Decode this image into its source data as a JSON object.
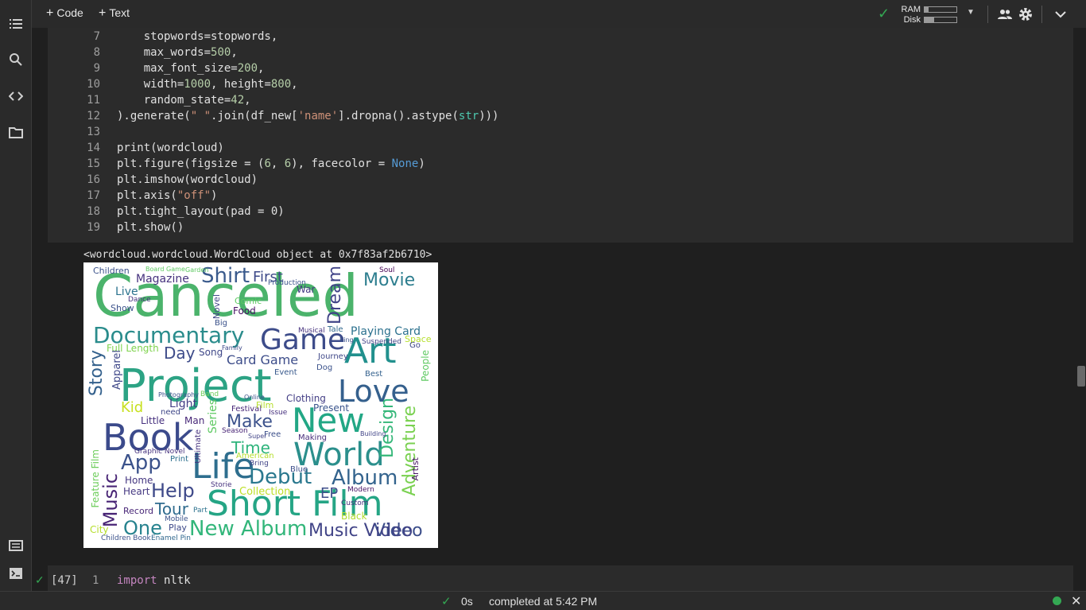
{
  "toolbar": {
    "add_code": "Code",
    "add_text": "Text",
    "ram_label": "RAM",
    "disk_label": "Disk",
    "ram_usage": 0.12,
    "disk_usage": 0.3
  },
  "sidebar": {
    "items": [
      "table-of-contents-icon",
      "search-icon",
      "code-snippets-icon",
      "files-icon",
      "command-palette-icon",
      "terminal-icon"
    ]
  },
  "cell": {
    "lines": [
      {
        "n": "7",
        "code": "    stopwords=stopwords,"
      },
      {
        "n": "8",
        "code": "    max_words=500,"
      },
      {
        "n": "9",
        "code": "    max_font_size=200,"
      },
      {
        "n": "10",
        "code": "    width=1000, height=800,"
      },
      {
        "n": "11",
        "code": "    random_state=42,"
      },
      {
        "n": "12",
        "code": ").generate(\" \".join(df_new['name'].dropna().astype(str)))"
      },
      {
        "n": "13",
        "code": ""
      },
      {
        "n": "14",
        "code": "print(wordcloud)"
      },
      {
        "n": "15",
        "code": "plt.figure(figsize = (6, 6), facecolor = None)"
      },
      {
        "n": "16",
        "code": "plt.imshow(wordcloud)"
      },
      {
        "n": "17",
        "code": "plt.axis(\"off\")"
      },
      {
        "n": "18",
        "code": "plt.tight_layout(pad = 0)"
      },
      {
        "n": "19",
        "code": "plt.show()"
      }
    ]
  },
  "output": {
    "text": "<wordcloud.wordcloud.WordCloud object at 0x7f83af2b6710>"
  },
  "wordcloud": {
    "words": [
      {
        "t": "Canceled",
        "c": "#4bb36b"
      },
      {
        "t": "Project",
        "c": "#2ca384"
      },
      {
        "t": "Book",
        "c": "#3b4a8b"
      },
      {
        "t": "Short Film",
        "c": "#25a585"
      },
      {
        "t": "World",
        "c": "#2b8f8c"
      },
      {
        "t": "Life",
        "c": "#2e6e8e"
      },
      {
        "t": "New",
        "c": "#22a785"
      },
      {
        "t": "Art",
        "c": "#21908d"
      },
      {
        "t": "Love",
        "c": "#35608d"
      },
      {
        "t": "Game",
        "c": "#3d4c8a"
      },
      {
        "t": "Documentary",
        "c": "#2a8c8c"
      },
      {
        "t": "Shirt",
        "c": "#3a5a8c"
      },
      {
        "t": "Movie",
        "c": "#2c7d8e"
      },
      {
        "t": "Dream",
        "c": "#404387"
      },
      {
        "t": "Album",
        "c": "#33638d"
      },
      {
        "t": "Debut",
        "c": "#2a788e"
      },
      {
        "t": "Help",
        "c": "#3e4989"
      },
      {
        "t": "App",
        "c": "#3b528b"
      },
      {
        "t": "Music",
        "c": "#482475"
      },
      {
        "t": "Video",
        "c": "#3c4e8a"
      },
      {
        "t": "One",
        "c": "#26828e"
      },
      {
        "t": "New Album",
        "c": "#32b67a"
      },
      {
        "t": "Music Video",
        "c": "#414487"
      },
      {
        "t": "Tour",
        "c": "#2f6b8e"
      },
      {
        "t": "Adventure",
        "c": "#7ad151"
      },
      {
        "t": "Design",
        "c": "#35b779"
      },
      {
        "t": "Story",
        "c": "#34618d"
      },
      {
        "t": "Time",
        "c": "#2fb47c"
      },
      {
        "t": "Make",
        "c": "#3b518b"
      },
      {
        "t": "Day",
        "c": "#3e4c8a"
      },
      {
        "t": "Card Game",
        "c": "#3d4d8a"
      },
      {
        "t": "Playing Card",
        "c": "#2c718e"
      },
      {
        "t": "Magazine",
        "c": "#46327e"
      },
      {
        "t": "First",
        "c": "#3e4a89"
      },
      {
        "t": "Kid",
        "c": "#c8e020"
      },
      {
        "t": "Light",
        "c": "#433e85"
      },
      {
        "t": "Series",
        "c": "#5ec962"
      },
      {
        "t": "EP",
        "c": "#3d4e8a"
      },
      {
        "t": "Children",
        "c": "#3b528b"
      },
      {
        "t": "Live",
        "c": "#2c738e"
      },
      {
        "t": "Full Length",
        "c": "#7fd34e"
      },
      {
        "t": "Feature Film",
        "c": "#6ccd5a"
      },
      {
        "t": "Collection",
        "c": "#bddf26"
      },
      {
        "t": "Song",
        "c": "#3f4788"
      },
      {
        "t": "Apparel",
        "c": "#3f4889"
      },
      {
        "t": "Food",
        "c": "#471063"
      },
      {
        "t": "War",
        "c": "#443a83"
      },
      {
        "t": "Clothing",
        "c": "#433e85"
      },
      {
        "t": "Present",
        "c": "#3a548c"
      },
      {
        "t": "Home",
        "c": "#453781"
      },
      {
        "t": "Little",
        "c": "#46307e"
      },
      {
        "t": "Man",
        "c": "#482878"
      },
      {
        "t": "Heart",
        "c": "#453882"
      },
      {
        "t": "Record",
        "c": "#482677"
      },
      {
        "t": "City",
        "c": "#b5de2b"
      },
      {
        "t": "Children Book",
        "c": "#3b518b"
      },
      {
        "t": "Comic",
        "c": "#5ec962"
      },
      {
        "t": "Novel",
        "c": "#404588"
      },
      {
        "t": "Black",
        "c": "#b2dd2d"
      },
      {
        "t": "Blue",
        "c": "#3d4e8a"
      },
      {
        "t": "Making",
        "c": "#472d7b"
      },
      {
        "t": "Ultimate",
        "c": "#46337f"
      },
      {
        "t": "Festival",
        "c": "#482878"
      },
      {
        "t": "Journey",
        "c": "#3f4788"
      },
      {
        "t": "Artist",
        "c": "#471365"
      },
      {
        "t": "Free",
        "c": "#3c4f8a"
      },
      {
        "t": "Season",
        "c": "#482475"
      },
      {
        "t": "Event",
        "c": "#38598c"
      },
      {
        "t": "Best",
        "c": "#34618d"
      },
      {
        "t": "People",
        "c": "#5ec962"
      },
      {
        "t": "Soul",
        "c": "#440154"
      },
      {
        "t": "Space",
        "c": "#b5de2b"
      },
      {
        "t": "Go",
        "c": "#3f4788"
      },
      {
        "t": "Tale",
        "c": "#31688e"
      },
      {
        "t": "Musical",
        "c": "#46327e"
      },
      {
        "t": "Dog",
        "c": "#3b528b"
      },
      {
        "t": "Print",
        "c": "#2d708e"
      },
      {
        "t": "Play",
        "c": "#3e4989"
      },
      {
        "t": "Graphic Novel",
        "c": "#46327e"
      },
      {
        "t": "Film",
        "c": "#b5de2b"
      },
      {
        "t": "Issue",
        "c": "#46307e"
      },
      {
        "t": "need",
        "c": "#3f4788"
      },
      {
        "t": "Big",
        "c": "#3b528b"
      },
      {
        "t": "Show",
        "c": "#3b528b"
      },
      {
        "t": "Production",
        "c": "#3b528b"
      },
      {
        "t": "American",
        "c": "#b5de2b"
      },
      {
        "t": "Band",
        "c": "#6ccd5a"
      },
      {
        "t": "Photography",
        "c": "#3b528b"
      },
      {
        "t": "Part",
        "c": "#2c728e"
      },
      {
        "t": "Board Game",
        "c": "#5ec962"
      },
      {
        "t": "Suspended",
        "c": "#414487"
      },
      {
        "t": "Enamel Pin",
        "c": "#31688e"
      },
      {
        "t": "Custom",
        "c": "#46327e"
      },
      {
        "t": "Modern",
        "c": "#471365"
      },
      {
        "t": "Mobile",
        "c": "#3b528b"
      },
      {
        "t": "Family",
        "c": "#3e4a89"
      },
      {
        "t": "Building",
        "c": "#414487"
      },
      {
        "t": "Dance",
        "c": "#46327e"
      },
      {
        "t": "Bring",
        "c": "#414487"
      },
      {
        "t": "Online",
        "c": "#3b528b"
      },
      {
        "t": "Super",
        "c": "#414487"
      },
      {
        "t": "King",
        "c": "#3b528b"
      },
      {
        "t": "Storie",
        "c": "#46327e"
      },
      {
        "t": "Garden",
        "c": "#5ec962"
      }
    ]
  },
  "next_cell": {
    "exec_count": "[47]",
    "line_number": "1",
    "keyword": "import",
    "code": " nltk"
  },
  "status": {
    "duration": "0s",
    "completed": "completed at 5:42 PM"
  }
}
